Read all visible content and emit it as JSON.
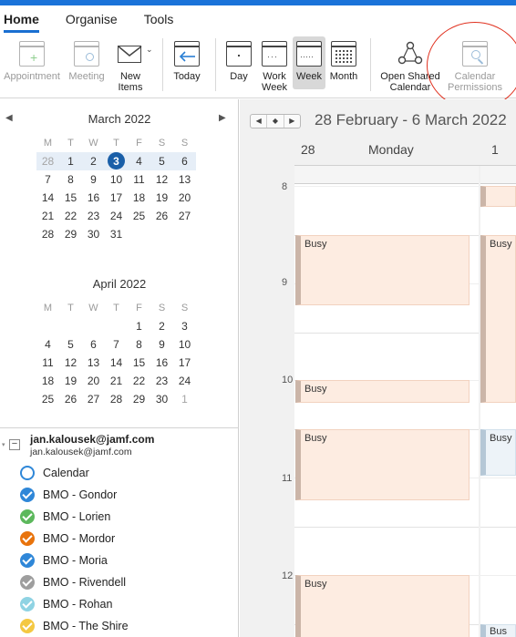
{
  "tabs": [
    {
      "label": "Home",
      "active": true
    },
    {
      "label": "Organise",
      "active": false
    },
    {
      "label": "Tools",
      "active": false
    }
  ],
  "ribbon": {
    "appointment": "Appointment",
    "meeting": "Meeting",
    "new_items_line1": "New",
    "new_items_line2": "Items",
    "today": "Today",
    "day": "Day",
    "work_week_line1": "Work",
    "work_week_line2": "Week",
    "week": "Week",
    "month": "Month",
    "open_shared_line1": "Open Shared",
    "open_shared_line2": "Calendar",
    "cal_perm_line1": "Calendar",
    "cal_perm_line2": "Permissions"
  },
  "mini_march": {
    "title": "March 2022",
    "headers": [
      "M",
      "T",
      "W",
      "T",
      "F",
      "S",
      "S"
    ],
    "rows": [
      [
        "28",
        "1",
        "2",
        "3",
        "4",
        "5",
        "6"
      ],
      [
        "7",
        "8",
        "9",
        "10",
        "11",
        "12",
        "13"
      ],
      [
        "14",
        "15",
        "16",
        "17",
        "18",
        "19",
        "20"
      ],
      [
        "21",
        "22",
        "23",
        "24",
        "25",
        "26",
        "27"
      ],
      [
        "28",
        "29",
        "30",
        "31",
        "",
        "",
        ""
      ]
    ],
    "today": "3"
  },
  "mini_april": {
    "title": "April 2022",
    "headers": [
      "M",
      "T",
      "W",
      "T",
      "F",
      "S",
      "S"
    ],
    "rows": [
      [
        "",
        "",
        "",
        "",
        "1",
        "2",
        "3"
      ],
      [
        "4",
        "5",
        "6",
        "7",
        "8",
        "9",
        "10"
      ],
      [
        "11",
        "12",
        "13",
        "14",
        "15",
        "16",
        "17"
      ],
      [
        "18",
        "19",
        "20",
        "21",
        "22",
        "23",
        "24"
      ],
      [
        "25",
        "26",
        "27",
        "28",
        "29",
        "30",
        "1"
      ]
    ]
  },
  "account": {
    "name": "jan.kalousek@jamf.com",
    "email": "jan.kalousek@jamf.com",
    "calendars": [
      {
        "label": "Calendar",
        "checked": false,
        "color": "#2f87d8"
      },
      {
        "label": "BMO - Gondor",
        "checked": true,
        "color": "#2f87d8"
      },
      {
        "label": "BMO - Lorien",
        "checked": true,
        "color": "#5cb85c"
      },
      {
        "label": "BMO - Mordor",
        "checked": true,
        "color": "#e8730c"
      },
      {
        "label": "BMO - Moria",
        "checked": true,
        "color": "#2f87d8"
      },
      {
        "label": "BMO - Rivendell",
        "checked": true,
        "color": "#9e9e9e"
      },
      {
        "label": "BMO - Rohan",
        "checked": true,
        "color": "#8fd3e3"
      },
      {
        "label": "BMO - The Shire",
        "checked": true,
        "color": "#f4c842"
      }
    ]
  },
  "calendar": {
    "range": "28 February - 6 March 2022",
    "day1_num": "28",
    "day1_name": "Monday",
    "day2_num": "1",
    "hours": [
      "8",
      "9",
      "10",
      "11",
      "12"
    ],
    "busy_label": "Busy",
    "busy_short": "Bus"
  }
}
